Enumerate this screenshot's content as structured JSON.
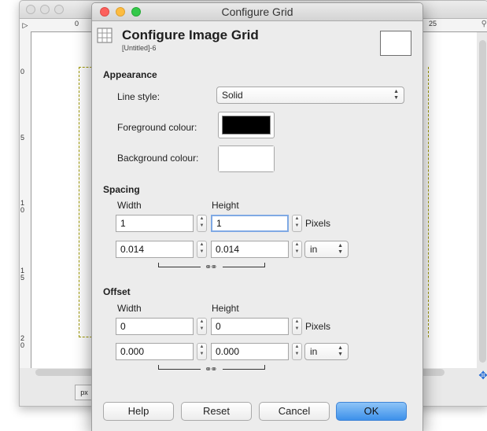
{
  "background_window": {
    "ruler_top_labels": [
      "0",
      "25"
    ],
    "ruler_left_labels": [
      "0",
      "5",
      "10",
      "15",
      "20"
    ],
    "unit_button": "px"
  },
  "dialog": {
    "window_title": "Configure Grid",
    "title": "Configure Image Grid",
    "subtitle": "[Untitled]-6"
  },
  "appearance": {
    "section_label": "Appearance",
    "line_style_label": "Line style:",
    "line_style_value": "Solid",
    "foreground_label": "Foreground colour:",
    "foreground_color": "#000000",
    "background_label": "Background colour:",
    "background_color": "#ffffff"
  },
  "spacing": {
    "section_label": "Spacing",
    "width_label": "Width",
    "height_label": "Height",
    "width_px": "1",
    "height_px": "1",
    "px_unit": "Pixels",
    "width_in": "0.014",
    "height_in": "0.014",
    "in_unit": "in"
  },
  "offset": {
    "section_label": "Offset",
    "width_label": "Width",
    "height_label": "Height",
    "width_px": "0",
    "height_px": "0",
    "px_unit": "Pixels",
    "width_in": "0.000",
    "height_in": "0.000",
    "in_unit": "in"
  },
  "buttons": {
    "help": "Help",
    "reset": "Reset",
    "cancel": "Cancel",
    "ok": "OK"
  },
  "colors": {
    "ok_accent": "#3c90ea",
    "close": "#fc605c",
    "minimize": "#fdbc40",
    "maximize": "#34c84a"
  }
}
